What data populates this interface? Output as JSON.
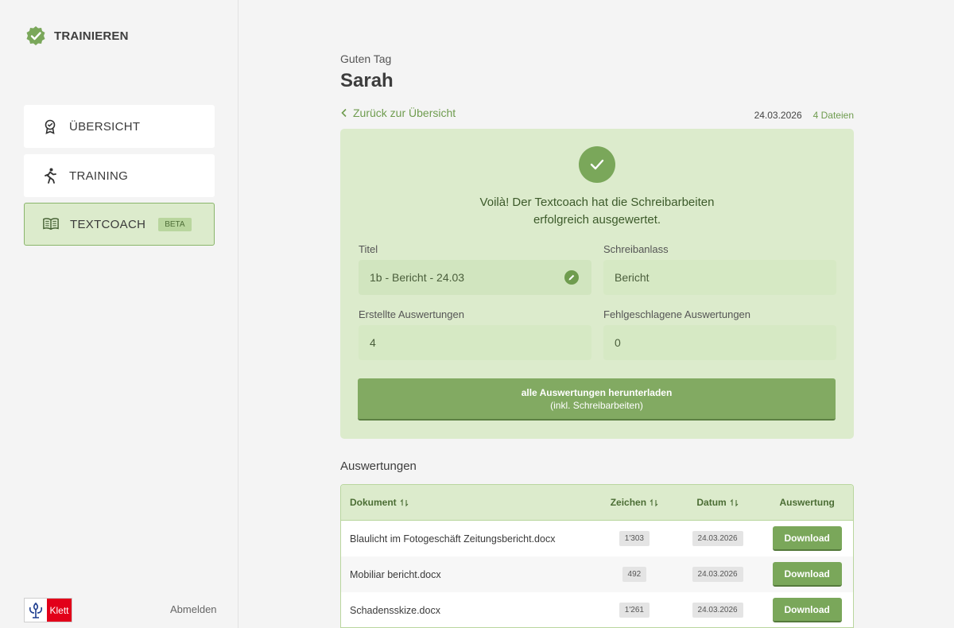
{
  "brand": {
    "name": "TRAINIEREN",
    "accent": "#7aa75a"
  },
  "sidebar": {
    "items": [
      {
        "label": "ÜBERSICHT",
        "icon": "award-icon"
      },
      {
        "label": "TRAINING",
        "icon": "runner-icon"
      },
      {
        "label": "TEXTCOACH",
        "icon": "open-book-icon",
        "badge": "BETA",
        "active": true
      }
    ],
    "logo_text": "Klett",
    "logout": "Abmelden"
  },
  "header": {
    "greeting": "Guten Tag",
    "user": "Sarah"
  },
  "nav": {
    "back": "Zurück zur Übersicht",
    "date": "24.03.2026",
    "files": "4 Dateien"
  },
  "result": {
    "message_line1": "Voilà! Der Textcoach hat die Schreibarbeiten",
    "message_line2": "erfolgreich ausgewertet.",
    "fields": {
      "title_label": "Titel",
      "title_value": "1b - Bericht - 24.03",
      "occasion_label": "Schreibanlass",
      "occasion_value": "Bericht",
      "created_label": "Erstellte Auswertungen",
      "created_value": "4",
      "failed_label": "Fehlgeschlagene Auswertungen",
      "failed_value": "0"
    },
    "download_all_line1": "alle Auswertungen herunterladen",
    "download_all_line2": "(inkl. Schreibarbeiten)"
  },
  "evaluations": {
    "title": "Auswertungen",
    "columns": {
      "document": "Dokument",
      "chars": "Zeichen",
      "date": "Datum",
      "evaluation": "Auswertung"
    },
    "rows": [
      {
        "document": "Blaulicht im Fotogeschäft Zeitungsbericht.docx",
        "chars": "1'303",
        "date": "24.03.2026",
        "action": "Download"
      },
      {
        "document": "Mobiliar bericht.docx",
        "chars": "492",
        "date": "24.03.2026",
        "action": "Download"
      },
      {
        "document": "Schadensskize.docx",
        "chars": "1'261",
        "date": "24.03.2026",
        "action": "Download"
      }
    ]
  }
}
